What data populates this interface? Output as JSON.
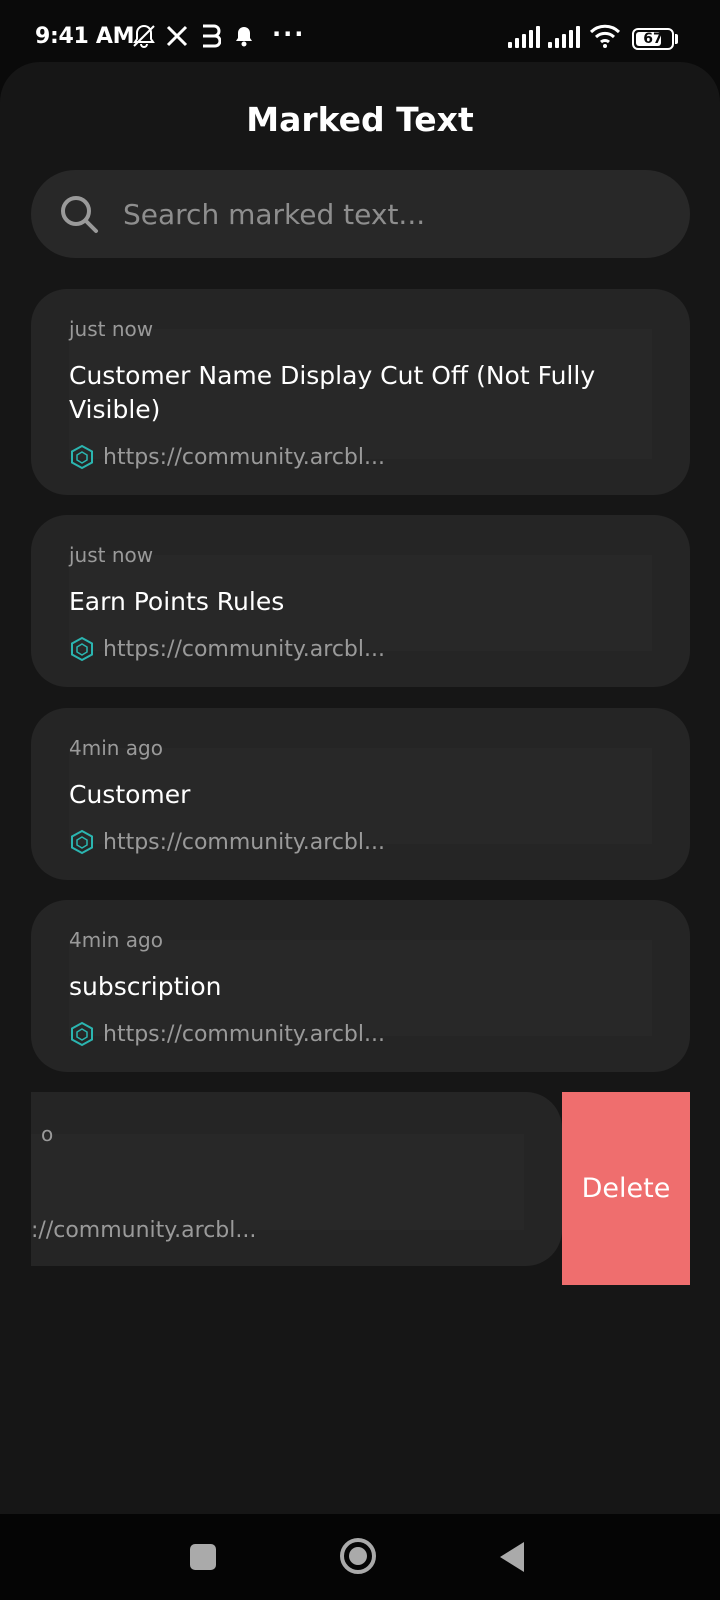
{
  "status_bar": {
    "time": "9:41 AM",
    "battery": "67",
    "icons": [
      "mute-bell-icon",
      "x-logo-icon",
      "app-icon",
      "bell-icon",
      "more-icon",
      "signal-icon",
      "wifi-icon",
      "battery-icon"
    ]
  },
  "header": {
    "title": "Marked Text"
  },
  "search": {
    "placeholder": "Search marked text..."
  },
  "items": [
    {
      "time": "just now",
      "title": "Customer Name Display Cut Off (Not Fully Visible)",
      "link": "https://community.arcbl..."
    },
    {
      "time": "just now",
      "title": "Earn Points Rules",
      "link": "https://community.arcbl..."
    },
    {
      "time": "4min ago",
      "title": "Customer",
      "link": "https://community.arcbl..."
    },
    {
      "time": "4min ago",
      "title": "subscription",
      "link": "https://community.arcbl..."
    },
    {
      "time_partial": "o",
      "link_partial": "://community.arcbl..."
    }
  ],
  "swipe_action": {
    "label": "Delete",
    "color": "#ef6e6e"
  },
  "colors": {
    "background": "#161616",
    "card": "#252525",
    "accent": "#2bb5b0"
  }
}
